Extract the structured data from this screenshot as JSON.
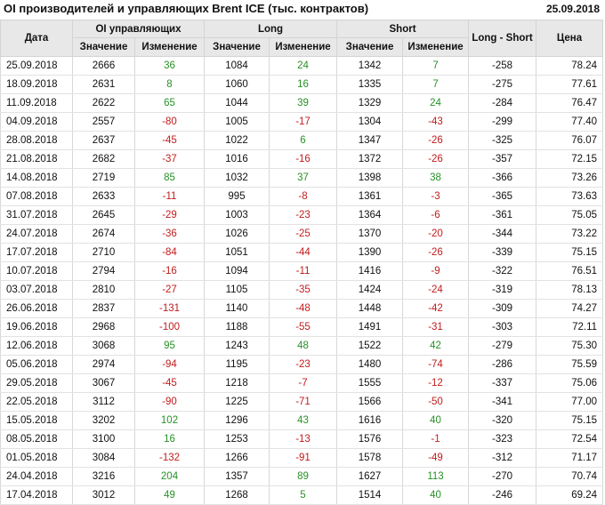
{
  "header": {
    "title": "OI производителей и управляющих Brent ICE (тыс. контрактов)",
    "date": "25.09.2018"
  },
  "table": {
    "col_date": "Дата",
    "group_oi": "OI управляющих",
    "group_long": "Long",
    "group_short": "Short",
    "col_ls": "Long - Short",
    "col_price": "Цена",
    "sub_value": "Значение",
    "sub_change": "Изменение",
    "rows": [
      [
        "25.09.2018",
        "2666",
        "36",
        "1084",
        "24",
        "1342",
        "7",
        "-258",
        "78.24"
      ],
      [
        "18.09.2018",
        "2631",
        "8",
        "1060",
        "16",
        "1335",
        "7",
        "-275",
        "77.61"
      ],
      [
        "11.09.2018",
        "2622",
        "65",
        "1044",
        "39",
        "1329",
        "24",
        "-284",
        "76.47"
      ],
      [
        "04.09.2018",
        "2557",
        "-80",
        "1005",
        "-17",
        "1304",
        "-43",
        "-299",
        "77.40"
      ],
      [
        "28.08.2018",
        "2637",
        "-45",
        "1022",
        "6",
        "1347",
        "-26",
        "-325",
        "76.07"
      ],
      [
        "21.08.2018",
        "2682",
        "-37",
        "1016",
        "-16",
        "1372",
        "-26",
        "-357",
        "72.15"
      ],
      [
        "14.08.2018",
        "2719",
        "85",
        "1032",
        "37",
        "1398",
        "38",
        "-366",
        "73.26"
      ],
      [
        "07.08.2018",
        "2633",
        "-11",
        "995",
        "-8",
        "1361",
        "-3",
        "-365",
        "73.63"
      ],
      [
        "31.07.2018",
        "2645",
        "-29",
        "1003",
        "-23",
        "1364",
        "-6",
        "-361",
        "75.05"
      ],
      [
        "24.07.2018",
        "2674",
        "-36",
        "1026",
        "-25",
        "1370",
        "-20",
        "-344",
        "73.22"
      ],
      [
        "17.07.2018",
        "2710",
        "-84",
        "1051",
        "-44",
        "1390",
        "-26",
        "-339",
        "75.15"
      ],
      [
        "10.07.2018",
        "2794",
        "-16",
        "1094",
        "-11",
        "1416",
        "-9",
        "-322",
        "76.51"
      ],
      [
        "03.07.2018",
        "2810",
        "-27",
        "1105",
        "-35",
        "1424",
        "-24",
        "-319",
        "78.13"
      ],
      [
        "26.06.2018",
        "2837",
        "-131",
        "1140",
        "-48",
        "1448",
        "-42",
        "-309",
        "74.27"
      ],
      [
        "19.06.2018",
        "2968",
        "-100",
        "1188",
        "-55",
        "1491",
        "-31",
        "-303",
        "72.11"
      ],
      [
        "12.06.2018",
        "3068",
        "95",
        "1243",
        "48",
        "1522",
        "42",
        "-279",
        "75.30"
      ],
      [
        "05.06.2018",
        "2974",
        "-94",
        "1195",
        "-23",
        "1480",
        "-74",
        "-286",
        "75.59"
      ],
      [
        "29.05.2018",
        "3067",
        "-45",
        "1218",
        "-7",
        "1555",
        "-12",
        "-337",
        "75.06"
      ],
      [
        "22.05.2018",
        "3112",
        "-90",
        "1225",
        "-71",
        "1566",
        "-50",
        "-341",
        "77.00"
      ],
      [
        "15.05.2018",
        "3202",
        "102",
        "1296",
        "43",
        "1616",
        "40",
        "-320",
        "75.15"
      ],
      [
        "08.05.2018",
        "3100",
        "16",
        "1253",
        "-13",
        "1576",
        "-1",
        "-323",
        "72.54"
      ],
      [
        "01.05.2018",
        "3084",
        "-132",
        "1266",
        "-91",
        "1578",
        "-49",
        "-312",
        "71.17"
      ],
      [
        "24.04.2018",
        "3216",
        "204",
        "1357",
        "89",
        "1627",
        "113",
        "-270",
        "70.74"
      ],
      [
        "17.04.2018",
        "3012",
        "49",
        "1268",
        "5",
        "1514",
        "40",
        "-246",
        "69.24"
      ]
    ]
  },
  "colors": {
    "positive": "#279127",
    "negative": "#c21c1c",
    "header_bg": "#e8e8e8"
  }
}
